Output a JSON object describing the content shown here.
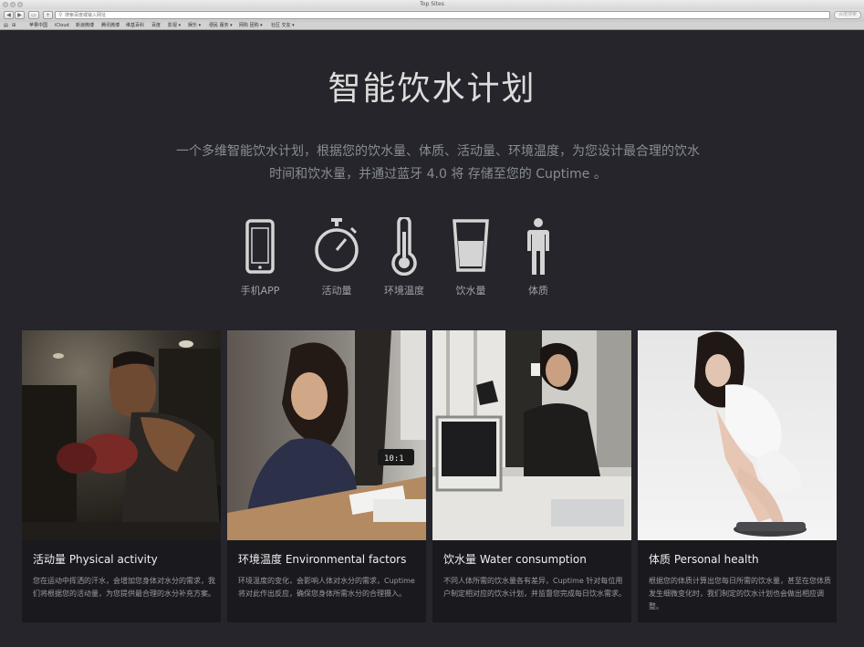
{
  "window": {
    "title": "Top Sites"
  },
  "toolbar": {
    "url_placeholder": "搜索百度或输入网址",
    "search_placeholder": "百度搜索"
  },
  "bookmarks": [
    "苹果中国",
    "iCloud",
    "新浪微博",
    "腾讯微博",
    "维基百科",
    "百度",
    "影视 ▾",
    "娱乐 ▾",
    "便民 服务 ▾",
    "网购 团购 ▾",
    "社区 交友 ▾"
  ],
  "hero": {
    "title": "智能饮水计划",
    "desc_line1": "一个多维智能饮水计划，根据您的饮水量、体质、活动量、环境温度，为您设计最合理的饮水",
    "desc_line2": "时间和饮水量，并通过蓝牙 4.0 将 存储至您的 Cuptime 。"
  },
  "features": [
    {
      "label": "手机APP",
      "icon": "phone-icon"
    },
    {
      "label": "活动量",
      "icon": "stopwatch-icon"
    },
    {
      "label": "环境温度",
      "icon": "thermometer-icon"
    },
    {
      "label": "饮水量",
      "icon": "cup-icon"
    },
    {
      "label": "体质",
      "icon": "person-icon"
    }
  ],
  "cards": [
    {
      "title": "活动量 Physical activity",
      "text": "您在运动中挥洒的汗水，会增加您身体对水分的需求，我们将根据您的活动量，为您提供最合理的水分补充方案。"
    },
    {
      "title": "环境温度 Environmental factors",
      "text": "环境温度的变化，会影响人体对水分的需求，Cuptime 将对此作出反应，确保您身体所需水分的合理摄入。"
    },
    {
      "title": "饮水量 Water consumption",
      "text": "不同人体所需的饮水量各有差异，Cuptime 针对每位用户制定相对应的饮水计划，并监督您完成每日饮水需求。"
    },
    {
      "title": "体质 Personal health",
      "text": "根据您的体质计算出您每日所需的饮水量，甚至在您体质发生细微变化时，我们制定的饮水计划也会做出相应调整。"
    }
  ]
}
